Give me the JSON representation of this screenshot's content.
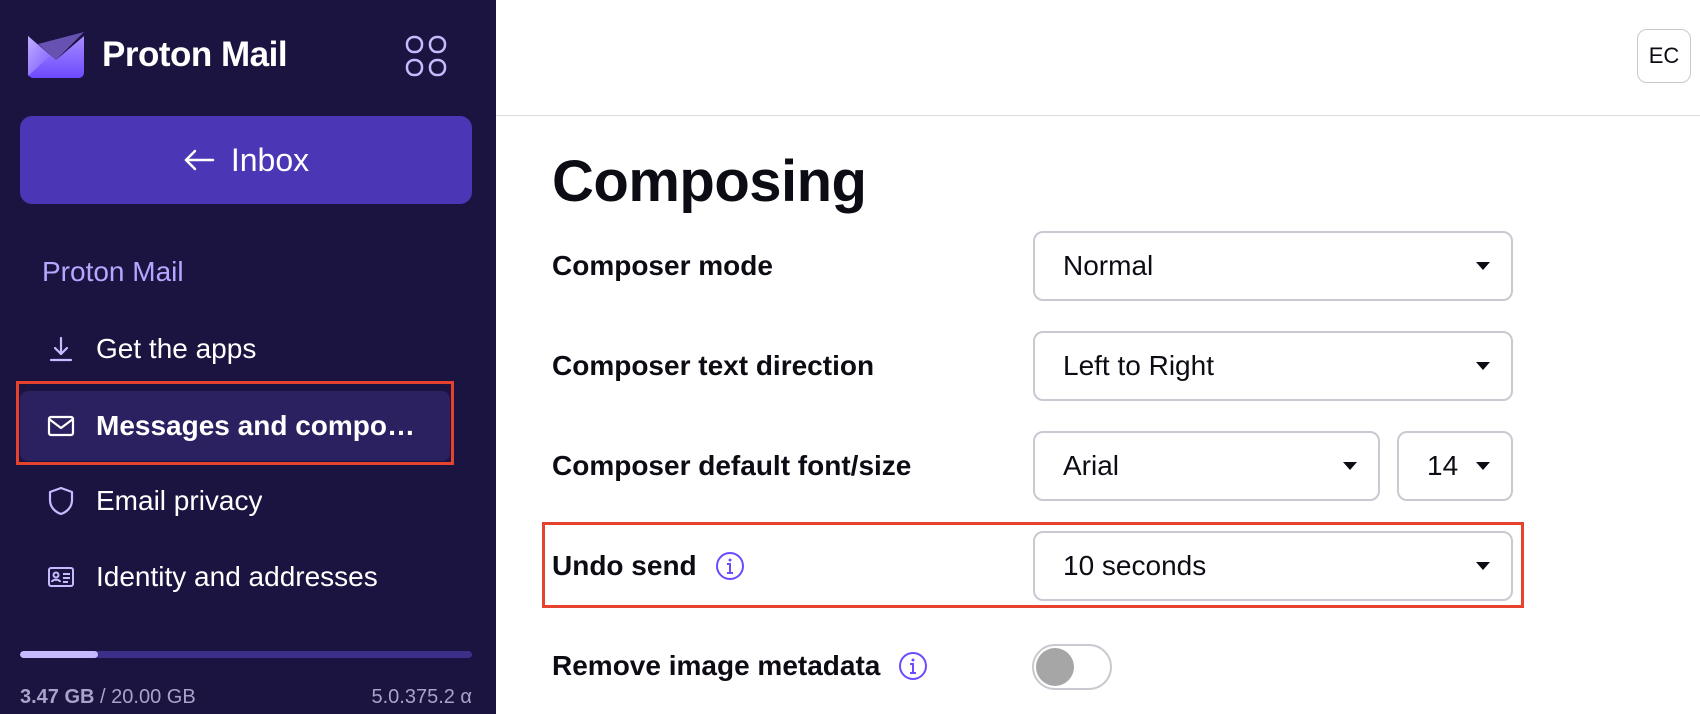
{
  "brand": {
    "name": "Proton Mail"
  },
  "sidebar": {
    "back_button": "Inbox",
    "section_label": "Proton Mail",
    "items": [
      {
        "label": "Get the apps",
        "icon": "download-icon",
        "active": false
      },
      {
        "label": "Messages and composing",
        "icon": "envelope-icon",
        "active": true
      },
      {
        "label": "Email privacy",
        "icon": "shield-icon",
        "active": false
      },
      {
        "label": "Identity and addresses",
        "icon": "id-card-icon",
        "active": false
      }
    ],
    "storage": {
      "used": "3.47 GB",
      "separator": " / ",
      "total": "20.00 GB",
      "fraction": 0.1735
    },
    "version": "5.0.375.2 α"
  },
  "header": {
    "avatar_initials": "EC"
  },
  "main": {
    "title": "Composing",
    "settings": [
      {
        "label": "Composer mode",
        "value": "Normal"
      },
      {
        "label": "Composer text direction",
        "value": "Left to Right"
      },
      {
        "label": "Composer default font/size",
        "value": "Arial",
        "size_value": "14"
      },
      {
        "label": "Undo send",
        "value": "10 seconds"
      },
      {
        "label": "Remove image metadata",
        "toggle_on": false
      }
    ]
  },
  "colors": {
    "sidebar_bg": "#1b1340",
    "accent": "#4b36b5",
    "highlight": "#e5432d",
    "section_label": "#b5a6ff"
  }
}
